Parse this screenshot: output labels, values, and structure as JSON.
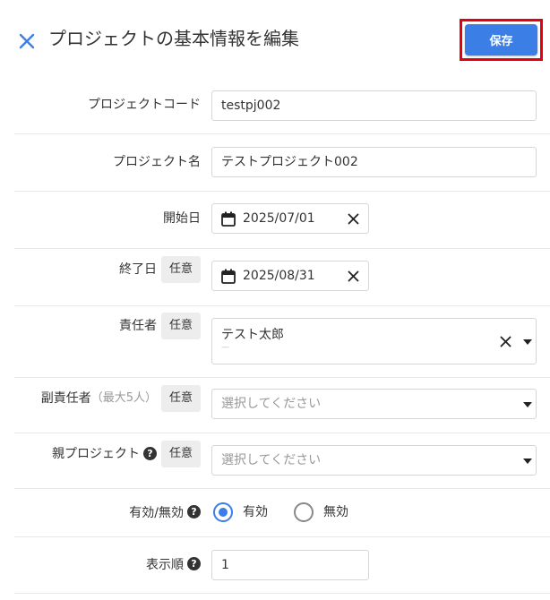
{
  "header": {
    "title": "プロジェクトの基本情報を編集",
    "save_label": "保存"
  },
  "form": {
    "optional_badge": "任意",
    "project_code": {
      "label": "プロジェクトコード",
      "value": "testpj002"
    },
    "project_name": {
      "label": "プロジェクト名",
      "value": "テストプロジェクト002"
    },
    "start_date": {
      "label": "開始日",
      "value": "2025/07/01"
    },
    "end_date": {
      "label": "終了日",
      "value": "2025/08/31"
    },
    "manager": {
      "label": "責任者",
      "value": "テスト太郎",
      "sub_value": "—"
    },
    "sub_manager": {
      "label": "副責任者",
      "note": "（最大5人）",
      "placeholder": "選択してください"
    },
    "parent_project": {
      "label": "親プロジェクト",
      "placeholder": "選択してください"
    },
    "status": {
      "label": "有効/無効",
      "option_active": "有効",
      "option_inactive": "無効",
      "selected": "active"
    },
    "display_order": {
      "label": "表示順",
      "value": "1"
    }
  },
  "icons": {
    "close": "close-icon",
    "calendar": "calendar-icon",
    "clear": "clear-icon",
    "dropdown": "chevron-down-icon",
    "help": "help-icon"
  },
  "colors": {
    "accent": "#3b7fe6",
    "highlight": "#e4000e"
  }
}
